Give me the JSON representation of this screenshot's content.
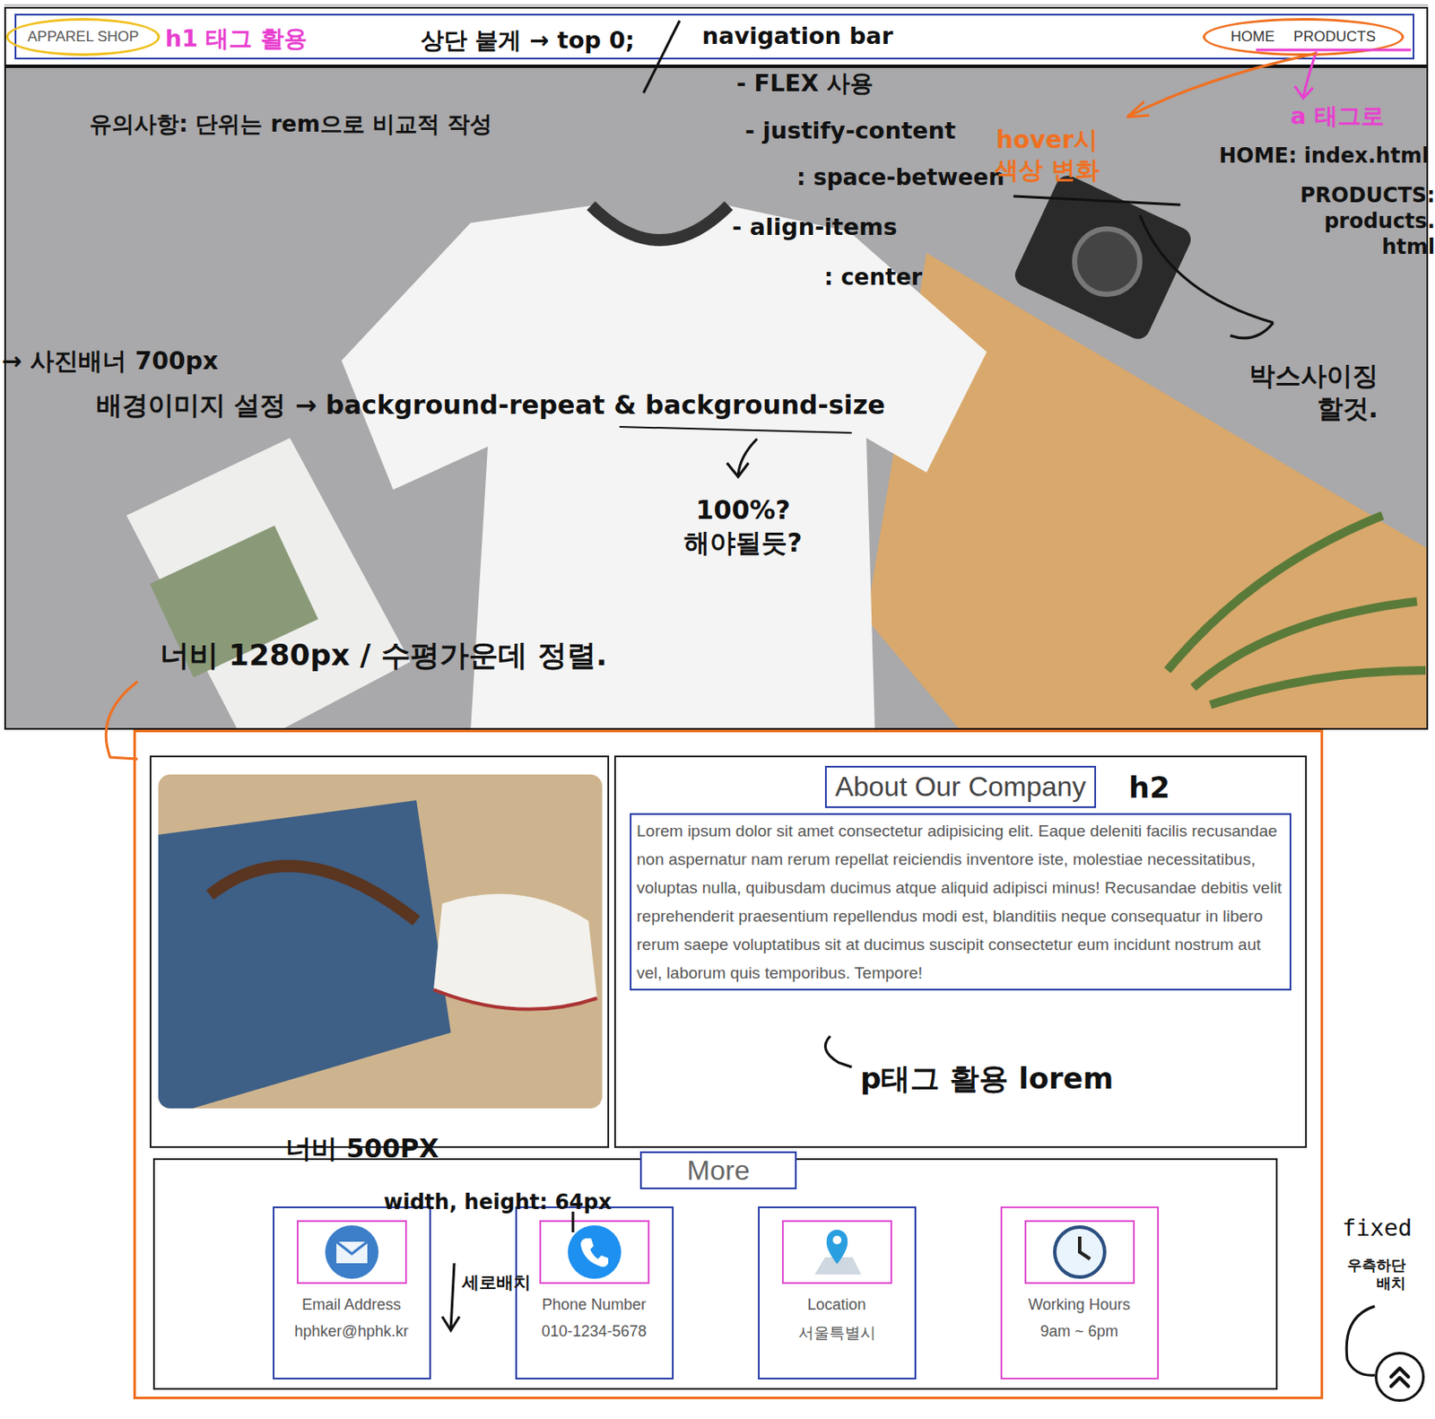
{
  "nav": {
    "logo": "APPAREL SHOP",
    "links": [
      {
        "label": "HOME"
      },
      {
        "label": "PRODUCTS"
      }
    ]
  },
  "about": {
    "title": "About Our Company",
    "body": "Lorem ipsum dolor sit amet consectetur adipisicing elit. Eaque deleniti facilis recusandae non aspernatur nam rerum repellat reiciendis inventore iste, molestiae necessitatibus, voluptas nulla, quibusdam ducimus atque aliquid adipisci minus! Recusandae debitis velit reprehenderit praesentium repellendus modi est, blanditiis neque consequatur in libero rerum saepe voluptatibus sit at ducimus suscipit consectetur eum incidunt nostrum aut vel, laborum quis temporibus. Tempore!"
  },
  "more": "More",
  "contacts": [
    {
      "label": "Email Address",
      "value": "hphker@hphk.kr",
      "kind": "email",
      "color": "#2a3fa8"
    },
    {
      "label": "Phone Number",
      "value": "010-1234-5678",
      "kind": "phone",
      "color": "#2a3fa8"
    },
    {
      "label": "Location",
      "value": "서울특별시",
      "kind": "location",
      "color": "#2a3fa8"
    },
    {
      "label": "Working Hours",
      "value": "9am ~ 6pm",
      "kind": "clock",
      "color": "#e04fd0"
    }
  ],
  "annotations": [
    {
      "text": "h1 태그 활용",
      "color": "#e83fd0"
    },
    {
      "text": "상단 붙게 → top 0;",
      "color": "#111111"
    },
    {
      "text": "navigation bar",
      "color": "#111111"
    },
    {
      "text": "- FLEX 사용",
      "color": "#111111"
    },
    {
      "text": "- justify-content",
      "color": "#111111"
    },
    {
      "text": ": space-between",
      "color": "#111111"
    },
    {
      "text": "- align-items",
      "color": "#111111"
    },
    {
      "text": ": center",
      "color": "#111111"
    },
    {
      "text": "유의사항: 단위는 rem으로 비교적 작성",
      "color": "#111111"
    },
    {
      "text": "hover시\n색상 변화",
      "color": "#f07020"
    },
    {
      "text": "a 태그로",
      "color": "#e83fd0"
    },
    {
      "text": "HOME: index.html",
      "color": "#111111"
    },
    {
      "text": "PRODUCTS: products.\nhtml",
      "color": "#111111"
    },
    {
      "text": "박스사이징\n할것.",
      "color": "#111111"
    },
    {
      "text": "→ 사진배너 700px",
      "color": "#111111"
    },
    {
      "text": "배경이미지 설정 → background-repeat & background-size",
      "color": "#111111"
    },
    {
      "text": "100%?\n해야될듯?",
      "color": "#111111"
    },
    {
      "text": "너비 1280px / 수평가운데 정렬.",
      "color": "#111111"
    },
    {
      "text": "h2",
      "color": "#111111"
    },
    {
      "text": "p태그 활용 lorem",
      "color": "#111111"
    },
    {
      "text": "너비 500PX",
      "color": "#111111"
    },
    {
      "text": "width, height: 64px",
      "color": "#111111"
    },
    {
      "text": "세로배치",
      "color": "#111111"
    },
    {
      "text": "fixed",
      "color": "#111111"
    },
    {
      "text": "우측하단\n배치",
      "color": "#111111"
    }
  ]
}
